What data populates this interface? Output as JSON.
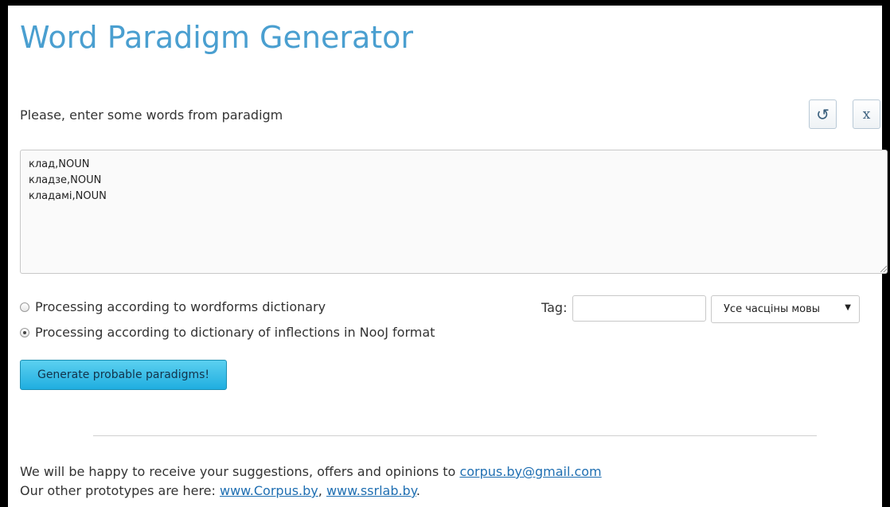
{
  "title": "Word Paradigm Generator",
  "prompt": "Please, enter some words from paradigm",
  "buttons": {
    "reset_icon": "↺",
    "clear_label": "x",
    "generate_label": "Generate probable paradigms!"
  },
  "words_input": {
    "value": "клад,NOUN\nкладзе,NOUN\nкладамі,NOUN"
  },
  "options": [
    {
      "label": "Processing according to wordforms dictionary",
      "checked": false
    },
    {
      "label": "Processing according to dictionary of inflections in NooJ format",
      "checked": true
    }
  ],
  "tag": {
    "label": "Tag:",
    "value": ""
  },
  "pos_select": {
    "selected": "Усе часціны мовы"
  },
  "footer": {
    "line1_text": "We will be happy to receive your suggestions, offers and opinions to ",
    "email": "corpus.by@gmail.com",
    "line2_text": "Our other prototypes are here: ",
    "link1": "www.Corpus.by",
    "separator": ", ",
    "link2": "www.ssrlab.by",
    "end": "."
  },
  "colors": {
    "title": "#4a9fd0",
    "link": "#1f6fb2",
    "button": "#20aee0"
  }
}
